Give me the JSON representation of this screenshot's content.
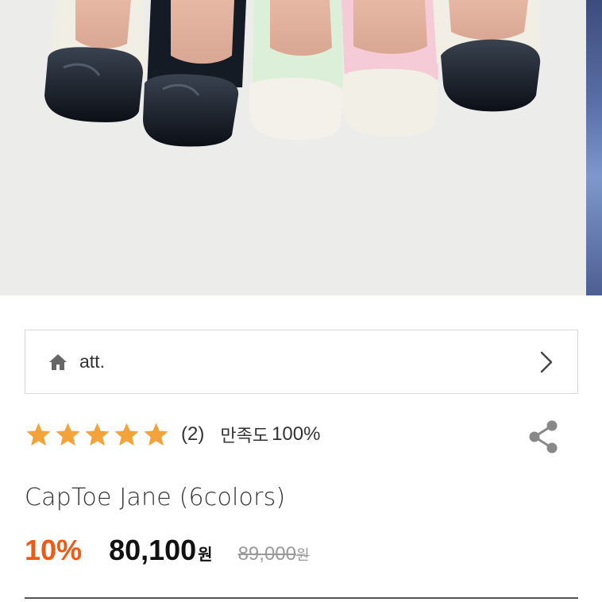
{
  "product_image": {
    "alt": "CapToe Jane shoes in six colors",
    "colors": [
      "#141a22",
      "#0f1720",
      "#dff0db",
      "#f3c9d4",
      "#f2efe6",
      "#182030"
    ]
  },
  "brand": {
    "name": "att.",
    "icon": "home-icon"
  },
  "rating": {
    "stars": 5,
    "review_count": "(2)",
    "satisfaction_label": "만족도",
    "satisfaction_value": "100%",
    "star_color": "#f4a23a"
  },
  "product": {
    "name": "CapToe Jane (6colors)"
  },
  "price": {
    "discount": "10%",
    "sale_price": "80,100",
    "sale_unit": "원",
    "original_price": "89,000",
    "original_unit": "원",
    "discount_color": "#ef5a14"
  }
}
